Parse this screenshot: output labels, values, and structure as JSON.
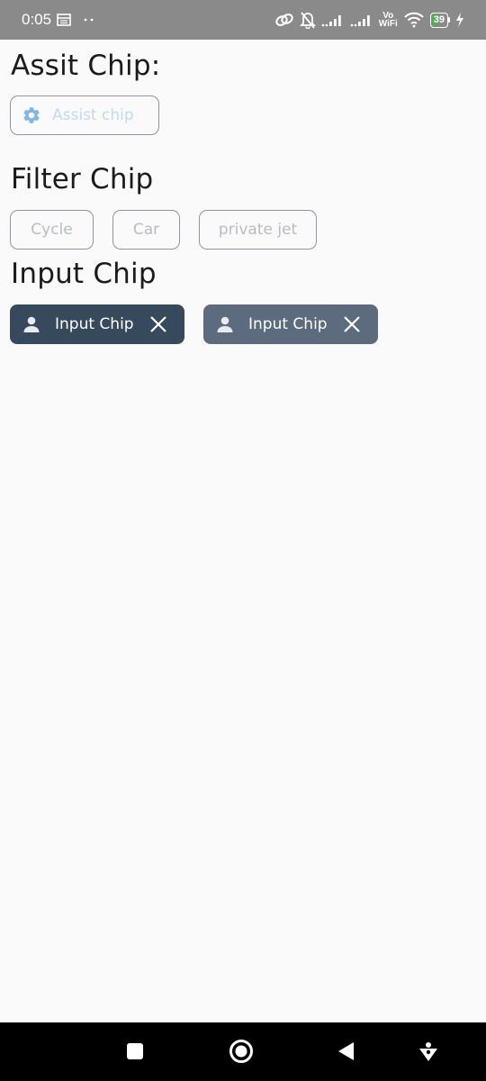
{
  "status_bar": {
    "time": "0:05",
    "vowifi_top": "Vo",
    "vowifi_bottom": "WiFi",
    "battery_level": "39",
    "battery_fraction": 0.39,
    "icons": [
      "notes-icon",
      "dots-icon",
      "link-icon",
      "bell-off-icon",
      "signal-icon",
      "signal-icon",
      "wifi-icon",
      "battery-icon",
      "charging-icon"
    ]
  },
  "sections": {
    "assist": {
      "title": "Assit Chip:",
      "chip_label": "Assist chip",
      "chip_icon": "settings-icon"
    },
    "filter": {
      "title": "Filter Chip",
      "chips": [
        "Cycle",
        "Car",
        "private jet"
      ]
    },
    "input": {
      "title": "Input Chip",
      "chips": [
        {
          "label": "Input Chip",
          "leading_icon": "person-icon",
          "trailing_icon": "close-icon",
          "color": "#37495c"
        },
        {
          "label": "Input Chip",
          "leading_icon": "person-icon",
          "trailing_icon": "close-icon",
          "color": "#5c6b7d"
        }
      ]
    }
  },
  "nav_bar": {
    "items": [
      "recents-square-icon",
      "home-circle-icon",
      "back-triangle-icon",
      "assistant-icon"
    ]
  },
  "colors": {
    "background": "#fafafa",
    "status_bar": "#8a8a8a",
    "chip_outline": "#8e96a3",
    "assist_text": "#c3d9ef",
    "assist_icon": "#7fb6ea",
    "battery_fill": "#4caf50"
  }
}
